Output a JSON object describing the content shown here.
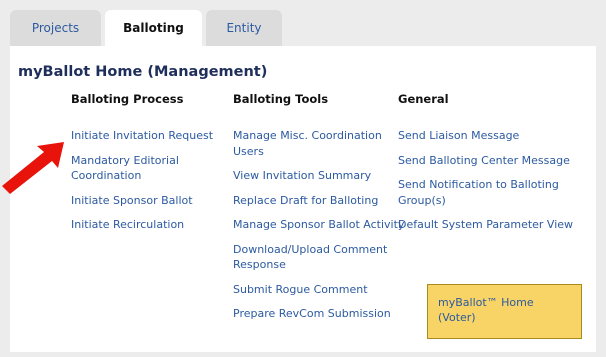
{
  "tabs": [
    {
      "label": "Projects",
      "active": false
    },
    {
      "label": "Balloting",
      "active": true
    },
    {
      "label": "Entity",
      "active": false
    }
  ],
  "page_title": "myBallot Home (Management)",
  "columns": {
    "process": {
      "heading": "Balloting Process",
      "links": [
        "Initiate Invitation Request",
        "Mandatory Editorial Coordination",
        "Initiate Sponsor Ballot",
        "Initiate Recirculation"
      ]
    },
    "tools": {
      "heading": "Balloting Tools",
      "links": [
        "Manage Misc. Coordination Users",
        "View Invitation Summary",
        "Replace Draft for Balloting",
        "Manage Sponsor Ballot Activity",
        "Download/Upload Comment Response",
        "Submit Rogue Comment",
        "Prepare RevCom Submission"
      ]
    },
    "general": {
      "heading": "General",
      "links": [
        "Send Liaison Message",
        "Send Balloting Center Message",
        "Send Notification to Balloting Group(s)",
        "Default System Parameter View"
      ]
    }
  },
  "voter_link": "myBallot™ Home (Voter)",
  "colors": {
    "link": "#2c5aa0",
    "arrow": "#e8140c",
    "voter_box": "#f8d466",
    "tab_inactive": "#dcdcdc",
    "page_background": "#ececec"
  },
  "icons": [
    "red-arrow-icon"
  ]
}
